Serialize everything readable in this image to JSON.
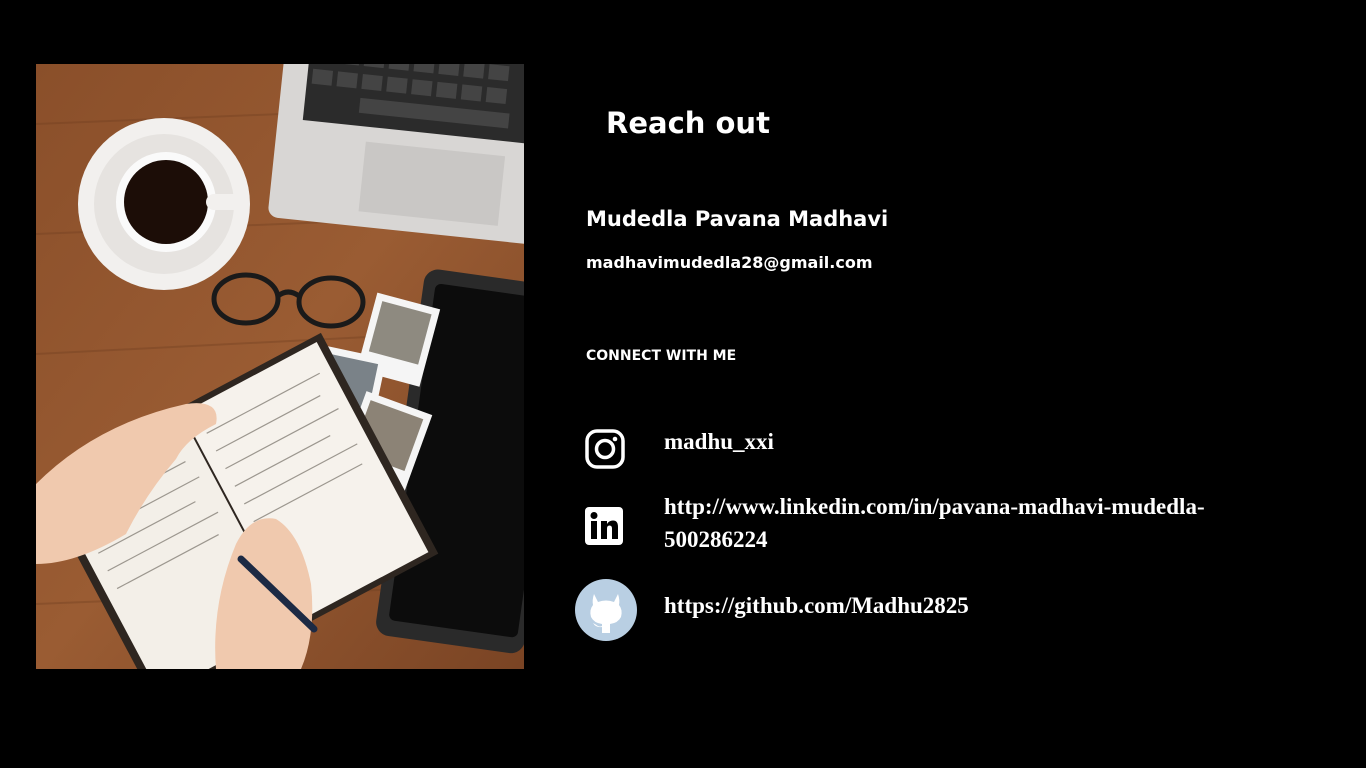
{
  "contact": {
    "heading": "Reach out",
    "name": "Mudedla Pavana Madhavi",
    "email": "madhavimudedla28@gmail.com",
    "connect_label": "CONNECT WITH ME"
  },
  "socials": [
    {
      "icon": "instagram-icon",
      "text": "madhu_xxi"
    },
    {
      "icon": "linkedin-icon",
      "text": "http://www.linkedin.com/in/pavana-madhavi-mudedla-500286224"
    },
    {
      "icon": "github-icon",
      "text": "https://github.com/Madhu2825"
    }
  ],
  "colors": {
    "background": "#000000",
    "text": "#ffffff",
    "github_circle": "#b9cfe3"
  }
}
